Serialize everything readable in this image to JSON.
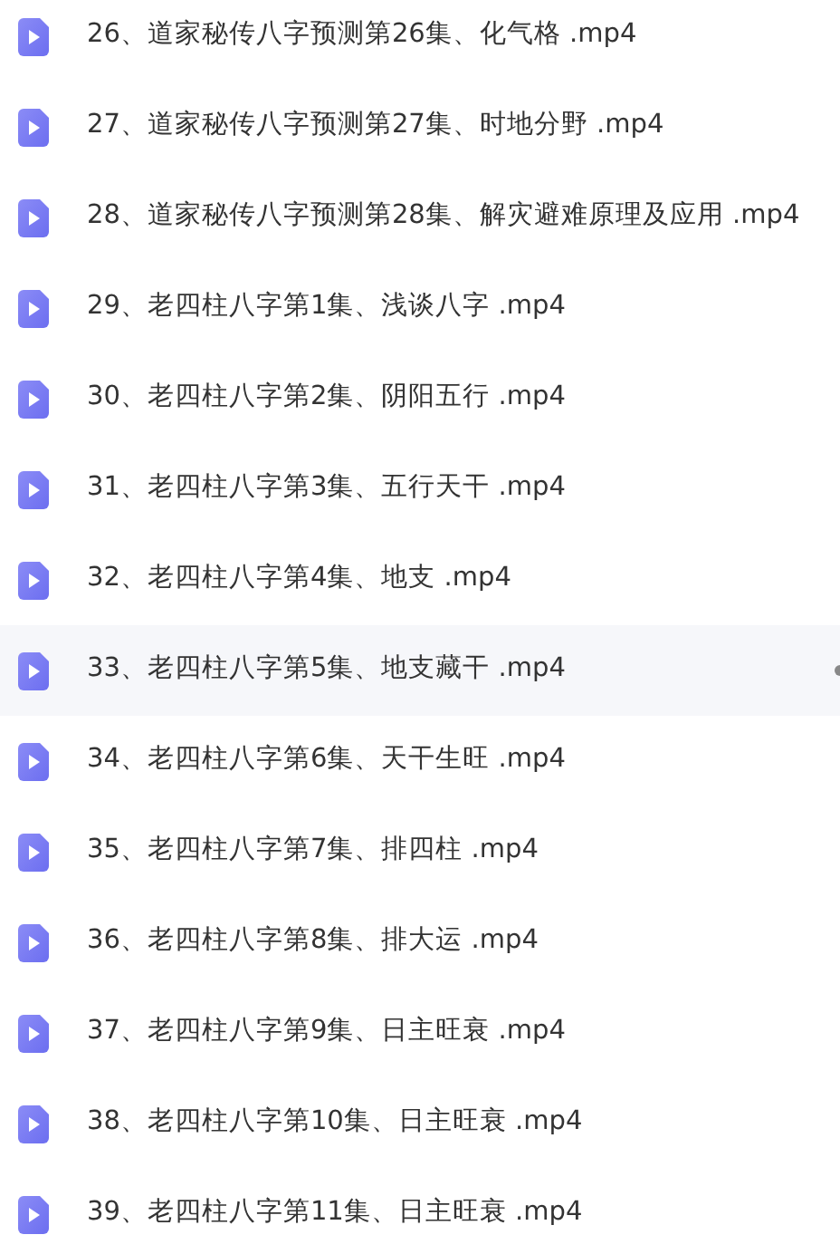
{
  "files": [
    {
      "name": "26、道家秘传八字预测第26集、化气格 .mp4",
      "selected": false
    },
    {
      "name": "27、道家秘传八字预测第27集、时地分野 .mp4",
      "selected": false
    },
    {
      "name": "28、道家秘传八字预测第28集、解灾避难原理及应用 .mp4",
      "selected": false
    },
    {
      "name": "29、老四柱八字第1集、浅谈八字 .mp4",
      "selected": false
    },
    {
      "name": "30、老四柱八字第2集、阴阳五行 .mp4",
      "selected": false
    },
    {
      "name": "31、老四柱八字第3集、五行天干 .mp4",
      "selected": false
    },
    {
      "name": "32、老四柱八字第4集、地支 .mp4",
      "selected": false
    },
    {
      "name": "33、老四柱八字第5集、地支藏干 .mp4",
      "selected": true
    },
    {
      "name": "34、老四柱八字第6集、天干生旺 .mp4",
      "selected": false
    },
    {
      "name": "35、老四柱八字第7集、排四柱 .mp4",
      "selected": false
    },
    {
      "name": "36、老四柱八字第8集、排大运 .mp4",
      "selected": false
    },
    {
      "name": "37、老四柱八字第9集、日主旺衰 .mp4",
      "selected": false
    },
    {
      "name": "38、老四柱八字第10集、日主旺衰 .mp4",
      "selected": false
    },
    {
      "name": "39、老四柱八字第11集、日主旺衰 .mp4",
      "selected": false
    }
  ]
}
